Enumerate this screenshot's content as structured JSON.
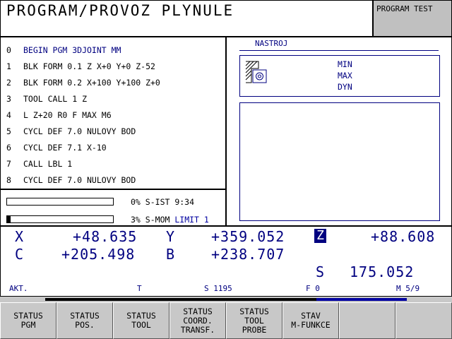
{
  "header": {
    "title": "PROGRAM/PROVOZ PLYNULE",
    "mode": "PROGRAM TEST"
  },
  "program": {
    "lines": [
      {
        "n": "0",
        "text": "BEGIN PGM 3DJOINT MM",
        "current": true
      },
      {
        "n": "1",
        "text": "BLK FORM 0.1 Z X+0 Y+0 Z-52",
        "current": false
      },
      {
        "n": "2",
        "text": "BLK FORM 0.2 X+100 Y+100 Z+0",
        "current": false
      },
      {
        "n": "3",
        "text": "TOOL CALL 1 Z",
        "current": false
      },
      {
        "n": "4",
        "text": "L Z+20 R0 F MAX M6",
        "current": false
      },
      {
        "n": "5",
        "text": "CYCL DEF 7.0 NULOVY BOD",
        "current": false
      },
      {
        "n": "6",
        "text": "CYCL DEF 7.1 X-10",
        "current": false
      },
      {
        "n": "7",
        "text": "CALL LBL 1",
        "current": false
      },
      {
        "n": "8",
        "text": "CYCL DEF 7.0 NULOVY BOD",
        "current": false
      }
    ]
  },
  "load": {
    "spindle": {
      "percent_label": "0%",
      "fill": 0.0,
      "label": "S-IST 9:34"
    },
    "torque": {
      "percent_label": "3%",
      "fill": 0.03,
      "label": "S-MOM",
      "limit": "LIMIT 1"
    }
  },
  "tool_panel": {
    "title": "NASTROJ",
    "labels": [
      "MIN",
      "MAX",
      "DYN"
    ],
    "icon": "tool-holder-icon"
  },
  "position": {
    "X": {
      "axis": "X",
      "value": "+48.635"
    },
    "Y": {
      "axis": "Y",
      "value": "+359.052"
    },
    "Z": {
      "axis": "Z",
      "value": "+88.608"
    },
    "C": {
      "axis": "C",
      "value": "+205.498"
    },
    "B": {
      "axis": "B",
      "value": "+238.707"
    },
    "S": {
      "axis": "S",
      "value": "175.052"
    }
  },
  "status_line": {
    "mode": "AKT.",
    "tool": "T",
    "spindle": "S 1195",
    "feed": "F 0",
    "mfunc": "M 5/9"
  },
  "softkeys": [
    [
      "STATUS",
      "PGM"
    ],
    [
      "STATUS",
      "POS."
    ],
    [
      "STATUS",
      "TOOL"
    ],
    [
      "STATUS",
      "COORD.",
      "TRANSF."
    ],
    [
      "STATUS",
      "TOOL",
      "PROBE"
    ],
    [
      "STAV",
      "M-FUNKCE"
    ],
    [],
    []
  ],
  "colors": {
    "accent": "#000080",
    "panel": "#ffffff",
    "chrome": "#c8c8c8"
  }
}
